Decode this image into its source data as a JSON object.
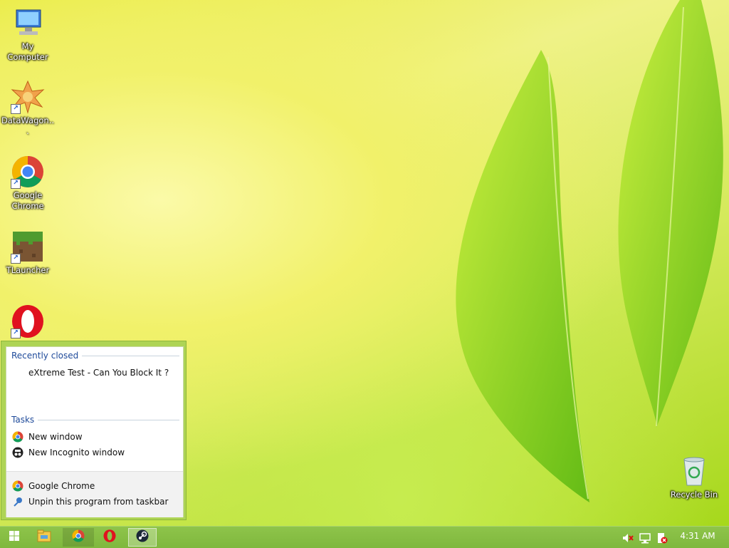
{
  "desktop": {
    "icons": [
      {
        "label": "My Computer",
        "icon": "computer-icon"
      },
      {
        "label": "DataWagon...",
        "icon": "datawagon-icon"
      },
      {
        "label": "Google Chrome",
        "icon": "chrome-icon"
      },
      {
        "label": "TLauncher",
        "icon": "minecraft-grass-icon"
      },
      {
        "label": "",
        "icon": "opera-icon"
      },
      {
        "label": "Recycle Bin",
        "icon": "recycle-bin-icon"
      }
    ]
  },
  "jumplist": {
    "recent_header": "Recently closed",
    "recent_items": [
      "eXtreme Test - Can You Block It ?"
    ],
    "tasks_header": "Tasks",
    "tasks": [
      {
        "label": "New window",
        "icon": "chrome-icon"
      },
      {
        "label": "New Incognito window",
        "icon": "incognito-icon"
      }
    ],
    "footer": [
      {
        "label": "Google Chrome",
        "icon": "chrome-icon"
      },
      {
        "label": "Unpin this program from taskbar",
        "icon": "unpin-icon"
      }
    ]
  },
  "taskbar": {
    "buttons": [
      "start-icon",
      "file-explorer-icon",
      "chrome-icon",
      "opera-icon",
      "steam-icon"
    ],
    "tray": [
      "volume-muted-icon",
      "network-icon",
      "action-center-icon"
    ],
    "clock": "4:31 AM"
  },
  "colors": {
    "taskbar": "#8ec44a",
    "jumplist_frame": "#aed455",
    "section_header": "#1e4a9a"
  }
}
